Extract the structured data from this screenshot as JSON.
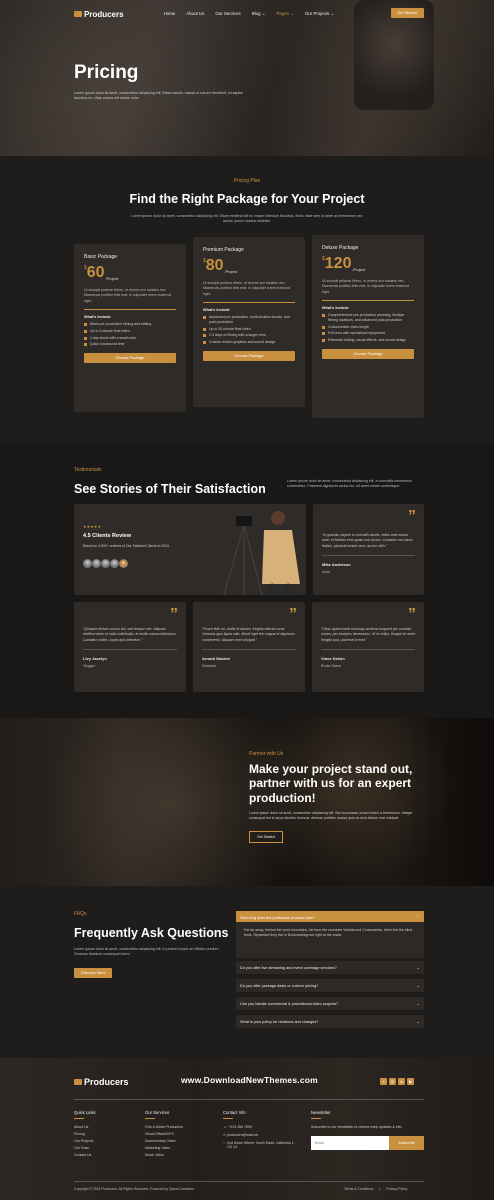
{
  "nav": {
    "brand": "Producers",
    "items": [
      "Home",
      "About Us",
      "Our Services",
      "Blog",
      "Pages",
      "Our Projects"
    ],
    "dropdown": "⌄",
    "cta": "Get Started"
  },
  "hero": {
    "title": "Pricing",
    "text": "Lorem ipsum dolor sit amet, consectetur adipiscing elit. Etiam iaculis, massa ut rutrum hendrerit, mi sapien faucibus ex, vitae cursus elit metus nunc."
  },
  "pricing": {
    "kicker": "Pricing Plan",
    "title": "Find the Right Package for Your Project",
    "subtitle": "Lorem ipsum dolor sit amet, consectetur adipiscing elit. Etiam eleifend elit eu neque interdum faucibus. Nunc vitae sem id amet at elementum nec auctor, ipsum massa molestie.",
    "plans": [
      {
        "name": "Basic Package",
        "currency": "$",
        "price": "60",
        "per": "/Project",
        "desc": "Ut suscipit pulvinar libero, ut viverra orci sodales nec. Maecenas porttitor felis erat, in vulputate lorem euismod eget.",
        "inc": "What's include",
        "features": [
          "Basic pre-production filming and editing",
          "Up to 2-minute final video",
          "1-day shoot with a small crew",
          "Quick turnaround time"
        ],
        "cta": "Choose Package"
      },
      {
        "name": "Premium Package",
        "currency": "$",
        "price": "80",
        "per": "/Project",
        "desc": "Ut suscipit pulvinar libero, ut viverra orci sodales nec. Maecenas porttitor felis erat, in vulputate lorem euismod eget.",
        "inc": "What's include",
        "features": [
          "Advanced pre-production, multi-location shoots, and post-production",
          "Up to 10-minute final video",
          "2-3 days of filming with a larger crew",
          "Custom motion graphics and sound design"
        ],
        "cta": "Choose Package"
      },
      {
        "name": "Deluxe Package",
        "currency": "$",
        "price": "120",
        "per": "/Project",
        "desc": "Ut suscipit pulvinar libero, ut viverra orci sodales nec. Maecenas porttitor felis erat, in vulputate lorem euismod eget.",
        "inc": "What's include",
        "features": [
          "Comprehensive pre-production planning, Multiple filming locations, and advanced post-production",
          "Customizable video length",
          "Full crew with specialized equipment",
          "Extensive editing, visual effects, and sound design"
        ],
        "cta": "Choose Package"
      }
    ]
  },
  "testimonials": {
    "kicker": "Testimonials",
    "title": "See Stories of Their Satisfaction",
    "subtitle": "Lorem ipsum dolor sit amet, consectetur adipiscing elit. In convallis elementum consectetur. Praesent dignissim varius leo, sit amet ornare scelerisque.",
    "rating": "★★★★★",
    "review_title": "4.5 Clients Review",
    "review_text": "Based on 3,500+ reviews of Our Satisfied Clients in 2024.",
    "quote_mark": "”",
    "add": "+",
    "items": [
      {
        "text": "\"In gravida, sapien in convallis iaculis, tellus ante auctor ante, et facilisis eros quam non ipsum. Curabitur non lacus finibus, placerat ornare arcu, auctor nibh.\"",
        "name": "Mike Anderson",
        "role": "Actor"
      },
      {
        "text": "\"Quisque dictum cursus dui, sed tempor nec. Aliquam eleifend dolor et nulla sollicitudin, et mollis massa bibendum. Curabitur mattis, turpis quis interdum.\"",
        "name": "Livy Jacelyn",
        "role": "Vlogger"
      },
      {
        "text": "\"Fusce felis mi, mollis id dictum, fringilla ultricies urna. Vivamus quis ligula odio. Morbi eget the magna et dignissim consectetur. Aliquam erat volutpat.\"",
        "name": "Arnold Gabriel",
        "role": "Musician"
      },
      {
        "text": "\"Class aptent taciti sociosqu ad litora torquent per conubia nostra, per inceptos himenaeos. Ut ex tellus, feugiat sit amet fringilla quis, placerat in erat.\"",
        "name": "Vince Delvin",
        "role": "Roots Owner"
      }
    ]
  },
  "partner": {
    "kicker": "Partner with Us",
    "title": "Make your project stand out, partner with us for an expert production!",
    "text": "Lorem ipsum dolor sit amet, consectetur adipiscing elit. Sed accumsan ornare lorem a fermentum. Integer consequat est in lacus lobortis rhoncus. Aenean porttitor massa quis ex duis dictum erat volutpat.",
    "cta": "Get Started"
  },
  "faq": {
    "kicker": "FAQs",
    "title": "Frequently Ask Questions",
    "text": "Lorem ipsum dolor sit amet, consectetur adipiscing elit. In pretium turpis ac efficitur pretium. Vivamus tincidunt consequat lorem.",
    "cta": "Discover More",
    "items": [
      {
        "q": "How long does the production process take?",
        "a": "Far far away, behind the word mountains, far from the countries Vokalia and Consonantia, there live the blind texts. Separated they live in Bookmarksgrove right at the coast."
      },
      {
        "q": "Do you offer live streaming and event coverage services?"
      },
      {
        "q": "Do you offer package deals or custom pricing?"
      },
      {
        "q": "Can you handle commercial & promotional video projects?"
      },
      {
        "q": "What is your policy for revisions and changes?"
      }
    ]
  },
  "footer": {
    "brand": "Producers",
    "watermark": "www.DownloadNewThemes.com",
    "social": [
      "f",
      "◎",
      "in",
      "▶"
    ],
    "quick_links": {
      "title": "Quick Links",
      "items": [
        "About Us",
        "Pricing",
        "Our Projects",
        "Our Team",
        "Contact Us"
      ]
    },
    "services": {
      "title": "Our Services",
      "items": [
        "Film & Movie Production",
        "Visual Effects/VFX",
        "Documentary Video",
        "Marketing Video",
        "Music Video"
      ]
    },
    "contact": {
      "title": "Contact Info",
      "phone": "+123 456 7890",
      "email": "producers@mail.net",
      "address": "2nd Some Where, North Earth, California 1-CD 14"
    },
    "newsletter": {
      "title": "Newsletter",
      "text": "Subscribe to our newsletter to receive early updates & info.",
      "placeholder": "Email",
      "cta": "Subscribe"
    },
    "copyright": "Copyright © 2024 Producers. All Rights Reserved. Powered by Qaizal Creatives",
    "terms": "Terms & Conditions",
    "privacy": "Privacy Policy",
    "separator": "|"
  }
}
